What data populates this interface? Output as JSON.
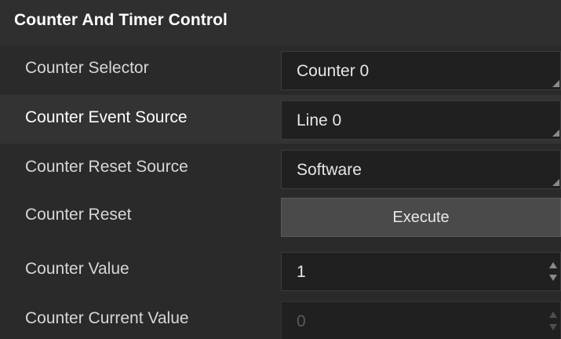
{
  "section": {
    "title": "Counter And Timer Control"
  },
  "rows": [
    {
      "label": "Counter Selector",
      "value": "Counter 0",
      "control": "dropdown"
    },
    {
      "label": "Counter Event Source",
      "value": "Line 0",
      "control": "dropdown"
    },
    {
      "label": "Counter Reset Source",
      "value": "Software",
      "control": "dropdown"
    },
    {
      "label": "Counter Reset",
      "value": "Execute",
      "control": "button"
    },
    {
      "label": "Counter Value",
      "value": "1",
      "control": "spinbox"
    },
    {
      "label": "Counter Current Value",
      "value": "0",
      "control": "spinbox",
      "disabled": true
    }
  ],
  "colors": {
    "background": "#2a2a2a",
    "field_background": "#202020",
    "button_background": "#4a4a4a",
    "label_text": "#d7d7d7",
    "disabled_text": "#5a5a5a"
  },
  "icons": {
    "dropdown": "dropdown-corner-icon",
    "spin_up": "spin-up-icon",
    "spin_down": "spin-down-icon"
  }
}
